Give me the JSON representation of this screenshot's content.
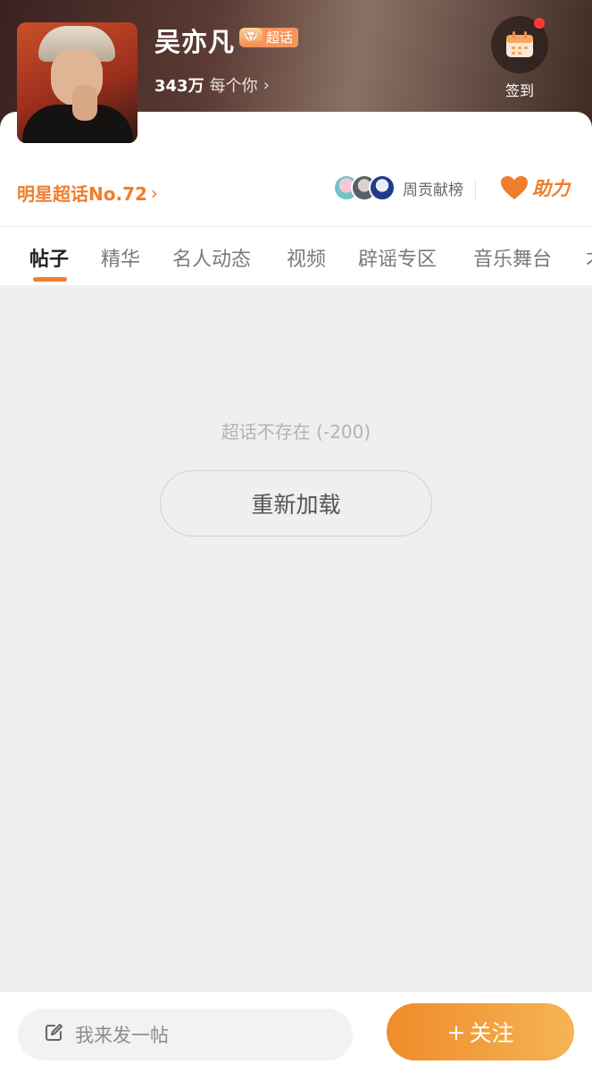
{
  "header": {
    "name": "吴亦凡",
    "badge_label": "超话",
    "followers_count": "343万",
    "followers_unit": "每个你",
    "checkin_label": "签到"
  },
  "info": {
    "rank_label": "明星超话No.72",
    "contrib_label": "周贡献榜",
    "support_label": "助力"
  },
  "tabs": [
    "帖子",
    "精华",
    "名人动态",
    "视频",
    "辟谣专区",
    "音乐舞台",
    "才"
  ],
  "active_tab": 0,
  "content": {
    "error_message": "超话不存在 (-200)",
    "reload_label": "重新加载"
  },
  "bottom": {
    "post_placeholder": "我来发一帖",
    "follow_label": "关注",
    "follow_icon": "+"
  },
  "colors": {
    "accent": "#ee7e2c",
    "follow_gradient_start": "#ef8b2a",
    "follow_gradient_end": "#f5b453",
    "badge": "#f7955c",
    "notification_dot": "#ff3b30"
  },
  "icons": {
    "badge": "diamond-icon",
    "checkin": "calendar-icon",
    "support": "heart-icon",
    "post": "edit-icon"
  }
}
